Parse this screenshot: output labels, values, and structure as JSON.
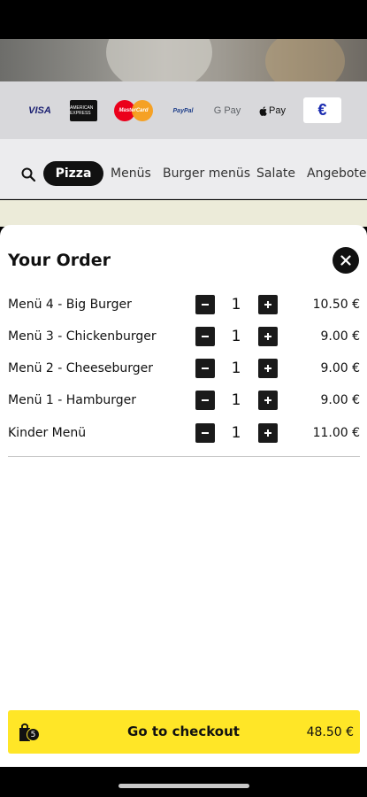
{
  "payments": {
    "visa": "VISA",
    "amex": "AMERICAN EXPRESS",
    "mastercard": "MasterCard",
    "paypal": "PayPal",
    "gpay": "G Pay",
    "applepay": "Pay",
    "euro": "€"
  },
  "nav": {
    "active": "Pizza",
    "items": [
      "Menüs",
      "Burger menüs",
      "Salate",
      "Angebote"
    ]
  },
  "order": {
    "title": "Your Order",
    "items": [
      {
        "name": "Menü 4 - Big Burger",
        "qty": "1",
        "price": "10.50 €"
      },
      {
        "name": "Menü 3 - Chickenburger",
        "qty": "1",
        "price": "9.00 €"
      },
      {
        "name": "Menü 2 - Cheeseburger",
        "qty": "1",
        "price": "9.00 €"
      },
      {
        "name": "Menü 1 - Hamburger",
        "qty": "1",
        "price": "9.00 €"
      },
      {
        "name": "Kinder Menü",
        "qty": "1",
        "price": "11.00 €"
      }
    ]
  },
  "checkout": {
    "label": "Go to checkout",
    "total": "48.50 €",
    "bag_count": "5"
  },
  "colors": {
    "accent": "#ffe627",
    "dark": "#111111"
  },
  "icons": {
    "search": "search-icon",
    "close": "close-icon",
    "minus": "minus-icon",
    "plus": "plus-icon",
    "bag": "shopping-bag-icon"
  }
}
